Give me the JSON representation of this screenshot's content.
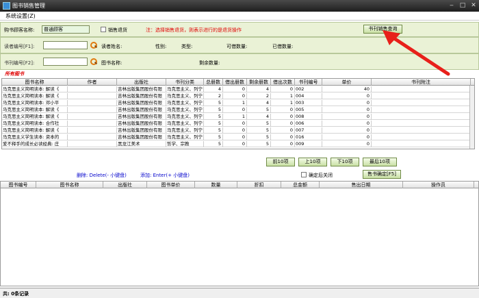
{
  "window": {
    "title": "图书销售管理"
  },
  "menu": {
    "system": "系统设置(Z)"
  },
  "top_panel": {
    "buyer_label": "购书顾客名称:",
    "buyer_value": "普通顾客",
    "return_label": "销售退货",
    "note": "注：选择销售退货，则表示进行的是退货操作",
    "query_button": "书刊销售查询"
  },
  "reader_panel": {
    "reader_no_label": "读者编号[F1]:",
    "reader_name_label": "读者姓名:",
    "gender_label": "性别:",
    "type_label": "类型:",
    "borrowable_label": "可借数量:",
    "borrowed_label": "已借数量:"
  },
  "book_panel": {
    "book_no_label": "书刊编号[F2]:",
    "book_name_label": "图书名称:",
    "remaining_label": "剩余数量:"
  },
  "section_title": "所有图书",
  "books_table": {
    "columns": [
      "图书名称",
      "作者",
      "出版社",
      "书刊分类",
      "总册数",
      "借出册数",
      "剩余册数",
      "借出次数",
      "书刊编号",
      "单价",
      "书刊附注"
    ],
    "rows": [
      [
        "马克思主义简明读本: 解读《",
        "",
        "吉林出版集团股份有限",
        "马克思主义、列宁",
        "4",
        "0",
        "4",
        "0",
        "002",
        "40",
        ""
      ],
      [
        "马克思主义简明读本: 解读《",
        "",
        "吉林出版集团股份有限",
        "马克思主义、列宁",
        "2",
        "0",
        "2",
        "1",
        "004",
        "0",
        ""
      ],
      [
        "马克思主义简明读本: 邓小平",
        "",
        "吉林出版集团股份有限",
        "马克思主义、列宁",
        "5",
        "1",
        "4",
        "1",
        "003",
        "0",
        ""
      ],
      [
        "马克思主义简明读本: 解读《",
        "",
        "吉林出版集团股份有限",
        "马克思主义、列宁",
        "5",
        "0",
        "5",
        "0",
        "005",
        "0",
        ""
      ],
      [
        "马克思主义简明读本: 解读《",
        "",
        "吉林出版集团股份有限",
        "马克思主义、列宁",
        "5",
        "1",
        "4",
        "0",
        "008",
        "0",
        ""
      ],
      [
        "马克思主义简明读本: 合作社",
        "",
        "吉林出版集团股份有限",
        "马克思主义、列宁",
        "5",
        "0",
        "5",
        "0",
        "006",
        "0",
        ""
      ],
      [
        "马克思主义简明读本: 解读《",
        "",
        "吉林出版集团股份有限",
        "马克思主义、列宁",
        "5",
        "0",
        "5",
        "0",
        "007",
        "0",
        ""
      ],
      [
        "马克思主义学生读本: 资本的",
        "",
        "吉林出版集团股份有限",
        "马克思主义、列宁",
        "5",
        "0",
        "5",
        "0",
        "016",
        "0",
        ""
      ],
      [
        "爱不释手的成长必读经典: 庄",
        "",
        "黑龙江美术",
        "哲学、宗教",
        "5",
        "0",
        "5",
        "0",
        "009",
        "0",
        ""
      ]
    ]
  },
  "nav_buttons": {
    "prev10": "前10项",
    "up10": "上10项",
    "next10": "下10项",
    "last10": "最后10项"
  },
  "hints": {
    "delete": "删除: Delete(- 小键盘)",
    "add": "添加: Enter(+ 小键盘)"
  },
  "close_after_confirm": "确定后关闭",
  "confirm_button": "售书确定[F5]",
  "sales_table": {
    "columns": [
      "图书编号",
      "图书名称",
      "出版社",
      "图书单价",
      "数量",
      "折扣",
      "总金额",
      "售出日期",
      "操作员"
    ]
  },
  "status": "共: 0条记录",
  "colors": {
    "accent_red": "#e00000",
    "panel_green": "#eaf2d6",
    "arrow": "#e8201a"
  }
}
